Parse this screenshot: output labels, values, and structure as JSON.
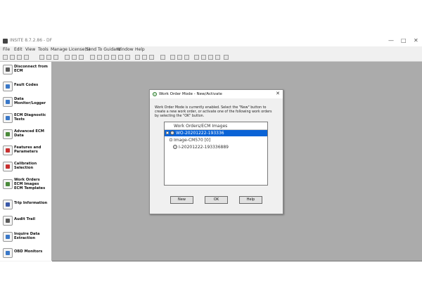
{
  "app": {
    "title": "INSITE 8.7.2.86 - DF"
  },
  "window_controls": {
    "minimize": "—",
    "maximize": "□",
    "close": "✕"
  },
  "menu": [
    "File",
    "Edit",
    "View",
    "Tools",
    "Manage License(s)",
    "Send To Guidanz",
    "Window",
    "Help"
  ],
  "sidebar": {
    "items": [
      {
        "label": "Disconnect from\nECM",
        "icon": "disconnect-icon",
        "color": "#5a5a5a"
      },
      {
        "label": "Fault Codes",
        "icon": "fault-codes-icon",
        "color": "#3a78c8"
      },
      {
        "label": "Data\nMonitor/Logger",
        "icon": "data-monitor-icon",
        "color": "#3a78c8"
      },
      {
        "label": "ECM Diagnostic\nTests",
        "icon": "diagnostic-tests-icon",
        "color": "#3a78c8"
      },
      {
        "label": "Advanced ECM\nData",
        "icon": "advanced-ecm-data-icon",
        "color": "#4a8a3a"
      },
      {
        "label": "Features and\nParameters",
        "icon": "features-parameters-icon",
        "color": "#c83030"
      },
      {
        "label": "Calibration\nSelection",
        "icon": "calibration-icon",
        "color": "#c83030"
      },
      {
        "label": "Work Orders\nECM Images\nECM Templates",
        "icon": "work-orders-icon",
        "color": "#4a8a3a"
      },
      {
        "label": "Trip Information",
        "icon": "trip-information-icon",
        "color": "#3a58a8"
      },
      {
        "label": "Audit Trail",
        "icon": "audit-trail-icon",
        "color": "#5a5a5a"
      },
      {
        "label": "Inquire Data\nExtraction",
        "icon": "inquire-data-icon",
        "color": "#3a78c8"
      },
      {
        "label": "OBD Monitors",
        "icon": "obd-monitors-icon",
        "color": "#3a78c8"
      }
    ]
  },
  "dialog": {
    "title": "Work Order Mode - New/Activate",
    "close": "✕",
    "message": "Work Order Mode is currently enabled. Select the \"New\" button to create a new work order, or activate one of the following work orders by selecting the \"OK\" button.",
    "tree": {
      "header": "Work Orders/ECM Images",
      "rows": [
        {
          "text": "WO-20201222-193336",
          "selected": true,
          "level": 0
        },
        {
          "text": "Image-CM570 [0]",
          "selected": false,
          "level": 1
        },
        {
          "text": "I-20201222-193336889",
          "selected": false,
          "level": 2
        }
      ]
    },
    "buttons": {
      "new": "New",
      "ok": "OK",
      "help": "Help"
    }
  }
}
